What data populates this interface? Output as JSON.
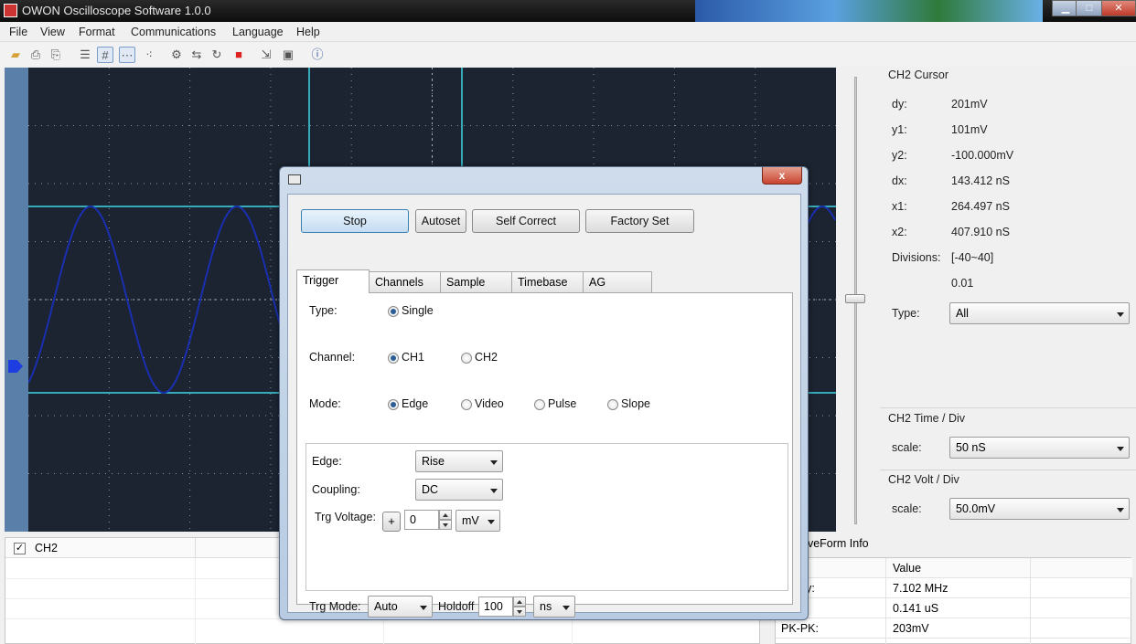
{
  "window": {
    "title": "OWON Oscilloscope Software 1.0.0",
    "min_label": "▁",
    "max_label": "□",
    "close_label": "✕"
  },
  "menu": [
    "File",
    "View",
    "Format",
    "Communications",
    "Language",
    "Help"
  ],
  "toolbar_icons": [
    "open-folder-icon",
    "print-icon",
    "print-preview-icon",
    "list-icon",
    "grid-icon",
    "dots-icon",
    "dotted-line-icon",
    "connect-icon",
    "transfer-icon",
    "refresh-icon",
    "stop-icon",
    "export-icon",
    "display-icon",
    "help-icon"
  ],
  "cursor_panel": {
    "title": "CH2 Cursor",
    "rows": [
      {
        "key": "dy:",
        "value": "201mV"
      },
      {
        "key": "y1:",
        "value": "101mV"
      },
      {
        "key": "y2:",
        "value": "-100.000mV"
      },
      {
        "key": "dx:",
        "value": "143.412 nS"
      },
      {
        "key": "x1:",
        "value": "264.497 nS"
      },
      {
        "key": "x2:",
        "value": "407.910 nS"
      },
      {
        "key": "Divisions:",
        "value": "[-40~40]"
      }
    ],
    "step": "0.01",
    "type_label": "Type:",
    "type_value": "All"
  },
  "time_div": {
    "title": "CH2 Time / Div",
    "scale_label": "scale:",
    "scale_value": "50 nS"
  },
  "volt_div": {
    "title": "CH2 Volt / Div",
    "scale_label": "scale:",
    "scale_value": "50.0mV"
  },
  "channel_list": {
    "label": "CH2",
    "checked": "✓"
  },
  "waveform_info": {
    "title": "aveForm Info",
    "value_header": "Value",
    "rows": [
      {
        "key": "uency:",
        "value": "7.102 MHz"
      },
      {
        "key": "d:",
        "value": "0.141 uS"
      },
      {
        "key": "PK-PK:",
        "value": "203mV"
      }
    ]
  },
  "dialog": {
    "close_label": "x",
    "buttons": {
      "stop": "Stop",
      "autoset": "Autoset",
      "self_correct": "Self Correct",
      "factory_set": "Factory Set"
    },
    "tabs": [
      "Trigger",
      "Channels",
      "Sample",
      "Timebase",
      "AG"
    ],
    "type_label": "Type:",
    "type_options": [
      "Single"
    ],
    "channel_label": "Channel:",
    "channel_options": [
      "CH1",
      "CH2"
    ],
    "mode_label": "Mode:",
    "mode_options": [
      "Edge",
      "Video",
      "Pulse",
      "Slope"
    ],
    "edge_label": "Edge:",
    "edge_value": "Rise",
    "coupling_label": "Coupling:",
    "coupling_value": "DC",
    "trg_voltage_label": "Trg Voltage:",
    "trg_voltage_sign": "+",
    "trg_voltage_value": "0",
    "trg_voltage_unit": "mV",
    "trg_mode_label": "Trg Mode:",
    "trg_mode_value": "Auto",
    "holdoff_label": "Holdoff",
    "holdoff_value": "100",
    "holdoff_unit": "ns"
  },
  "colors": {
    "scope_bg": "#1c2431",
    "trace": "#1a2fb0",
    "cursor_line": "#3fd7e6",
    "grid_dot": "#8a93a3"
  }
}
